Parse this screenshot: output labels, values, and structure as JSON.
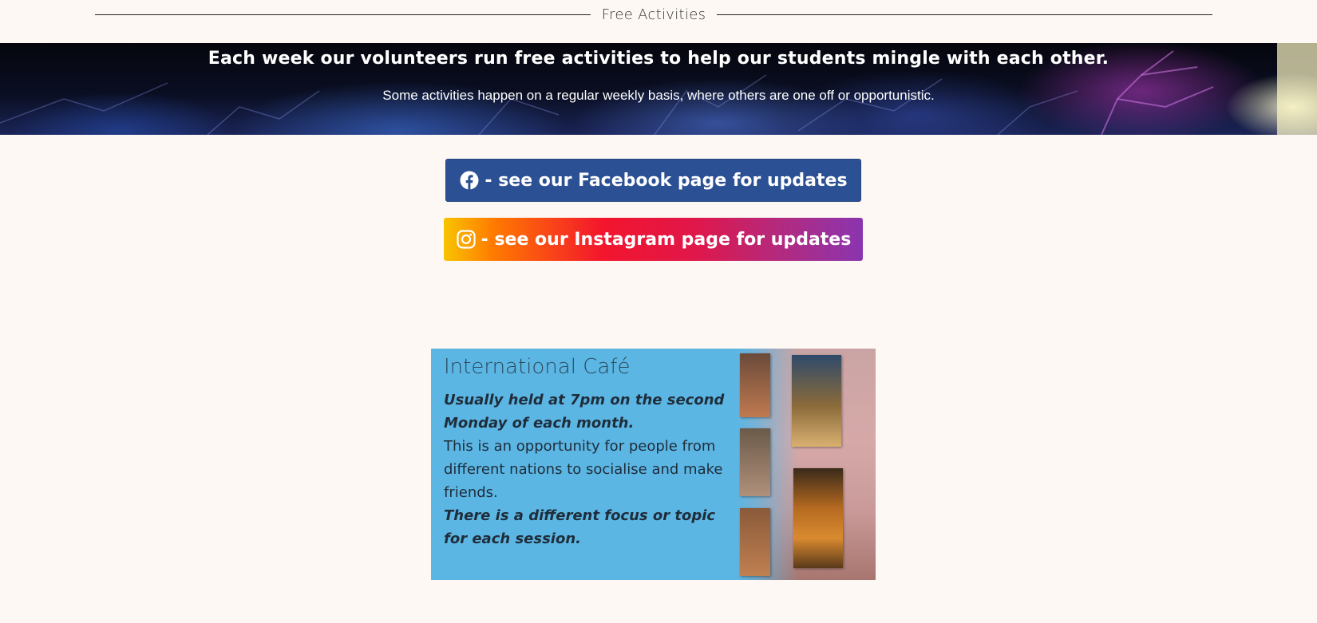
{
  "section": {
    "title": "Free Activities"
  },
  "banner": {
    "headline": "Each week our volunteers run free activities to help our students mingle with each other.",
    "subline": "Some activities happen on a regular weekly basis, where others are one off or opportunistic."
  },
  "social": {
    "facebook_label": "- see our Facebook page for updates",
    "instagram_label": "- see our Instagram page for updates",
    "facebook_icon": "facebook-icon",
    "instagram_icon": "instagram-icon"
  },
  "activities": [
    {
      "title": "International Café",
      "schedule": "Usually held at 7pm on the second Monday of each month.",
      "description": "This is an opportunity for people from different nations to socialise and make friends.",
      "note": "There is a different focus or topic for each session."
    }
  ],
  "colors": {
    "background": "#fdf8f3",
    "facebook": "#2c5094",
    "card": "#5cb6e4"
  }
}
